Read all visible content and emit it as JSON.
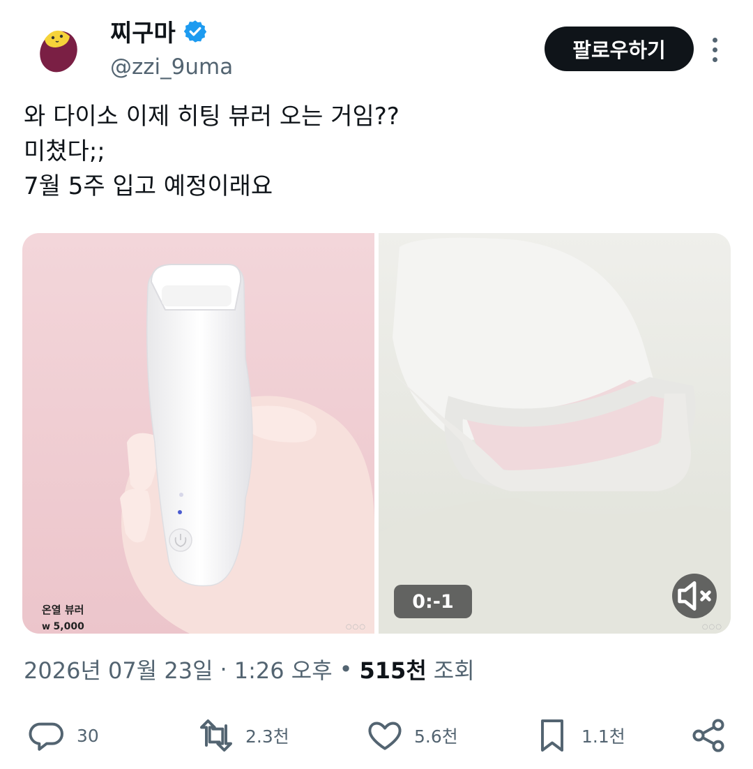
{
  "author": {
    "display_name": "찌구마",
    "handle": "@zzi_9uma",
    "verified_icon": "verified-badge-icon",
    "avatar_icon": "sweet-potato-avatar"
  },
  "follow_label": "팔로우하기",
  "tweet_text": "와 다이소 이제 히팅 뷰러 오는 거임??\n미쳤다;;\n7월 5주 입고 예정이래요",
  "media": {
    "image": {
      "caption_name": "온열 뷰러",
      "caption_price_symbol": "w",
      "caption_price": "5,000"
    },
    "video": {
      "timer": "0:-1",
      "mute_icon": "volume-muted-icon"
    }
  },
  "meta": {
    "date": "2026년 07월 23일",
    "separator": "·",
    "time": "1:26 오후",
    "views_separator": "•",
    "views_count": "515천",
    "views_label": "조회"
  },
  "actions": {
    "reply_count": "30",
    "retweet_count": "2.3천",
    "like_count": "5.6천",
    "bookmark_count": "1.1천"
  },
  "colors": {
    "text_primary": "#0f1419",
    "text_secondary": "#536471",
    "verified_blue": "#1d9bf0",
    "follow_bg": "#0f1419"
  }
}
